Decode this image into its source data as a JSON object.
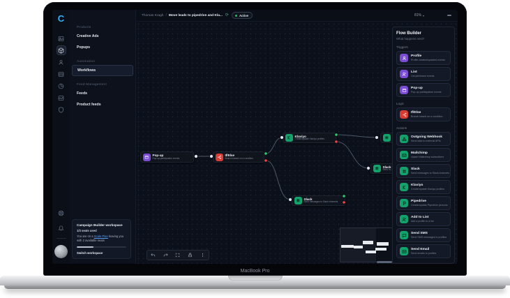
{
  "device": {
    "label": "MacBook Pro"
  },
  "brand": {
    "logo": "C"
  },
  "topbar": {
    "user": "Thomas Kragh",
    "separator": "/",
    "title": "Move leads to pipedrive and Kla...",
    "sync_icon": "⟳",
    "status": "Active",
    "zoom_level": "81%",
    "zoom_caret": "▾"
  },
  "sidebar": {
    "sections": [
      {
        "label": "Products",
        "items": [
          {
            "label": "Creative Ads"
          },
          {
            "label": "Popups"
          }
        ]
      },
      {
        "label": "Automation",
        "items": [
          {
            "label": "Workflows"
          }
        ]
      },
      {
        "label": "Feed Management",
        "items": [
          {
            "label": "Feeds"
          },
          {
            "label": "Product feeds"
          }
        ]
      }
    ]
  },
  "workspace": {
    "title": "Campaign Builder workspace",
    "seats": "1/3 seats used",
    "plan_prefix": "You are on a ",
    "plan_link": "Scale Plan",
    "plan_suffix": " leaving you with 2 available seats",
    "progress_percent": 33,
    "switch_label": "Switch workspace"
  },
  "canvas": {
    "nodes": [
      {
        "title": "Pop-up",
        "subtitle": "Pop-up participation events"
      },
      {
        "title": "If/Else",
        "subtitle": "Branch based on a condition"
      },
      {
        "title": "Klaviyo",
        "subtitle": "Create/update Klaviyo profiles"
      },
      {
        "title": "Slack",
        "subtitle": "Send m..."
      },
      {
        "title": "Slack",
        "subtitle": "Send messages to Slack channels"
      }
    ]
  },
  "flow_panel": {
    "title": "Flow Builder",
    "subtitle": "What happens next?",
    "sections": [
      {
        "label": "Triggers",
        "items": [
          {
            "title": "Profile",
            "subtitle": "Profile created/updated events",
            "icon": "user-icon"
          },
          {
            "title": "List",
            "subtitle": "List join/leave events",
            "icon": "user-plus-icon"
          },
          {
            "title": "Pop-up",
            "subtitle": "Pop-up participation events",
            "icon": "popup-icon"
          }
        ]
      },
      {
        "label": "Logic",
        "items": [
          {
            "title": "If/Else",
            "subtitle": "Branch based on a condition",
            "icon": "branch-icon"
          }
        ]
      },
      {
        "label": "Actions",
        "items": [
          {
            "title": "Outgoing Webhook",
            "subtitle": "Send data to external APIs",
            "icon": "webhook-icon"
          },
          {
            "title": "Mailchimp",
            "subtitle": "Upsert Mailchimp subscribers",
            "icon": "mail-icon"
          },
          {
            "title": "Slack",
            "subtitle": "Send messages to Slack channels",
            "icon": "slack-icon"
          },
          {
            "title": "Klaviyo",
            "subtitle": "Create/update Klaviyo profiles",
            "icon": "klaviyo-icon"
          },
          {
            "title": "Pipedrive",
            "subtitle": "Create/update Pipedrive persons",
            "icon": "pipedrive-icon"
          },
          {
            "title": "Add to List",
            "subtitle": "Add a profile to a list",
            "icon": "user-add-icon"
          },
          {
            "title": "Send SMS",
            "subtitle": "Send SMS messages to profiles",
            "icon": "chat-icon"
          },
          {
            "title": "Send Email",
            "subtitle": "Send emails to profiles",
            "icon": "mail-icon"
          }
        ]
      }
    ]
  },
  "colors": {
    "accent_purple": "#7c4dd4",
    "accent_red": "#d93b35",
    "accent_green": "#12a36c",
    "status_green": "#22c55e",
    "link_blue": "#5b9bf8",
    "logo_blue": "#3bb0f7",
    "app_bg": "#0b0f18",
    "panel_bg": "#0d121d"
  }
}
